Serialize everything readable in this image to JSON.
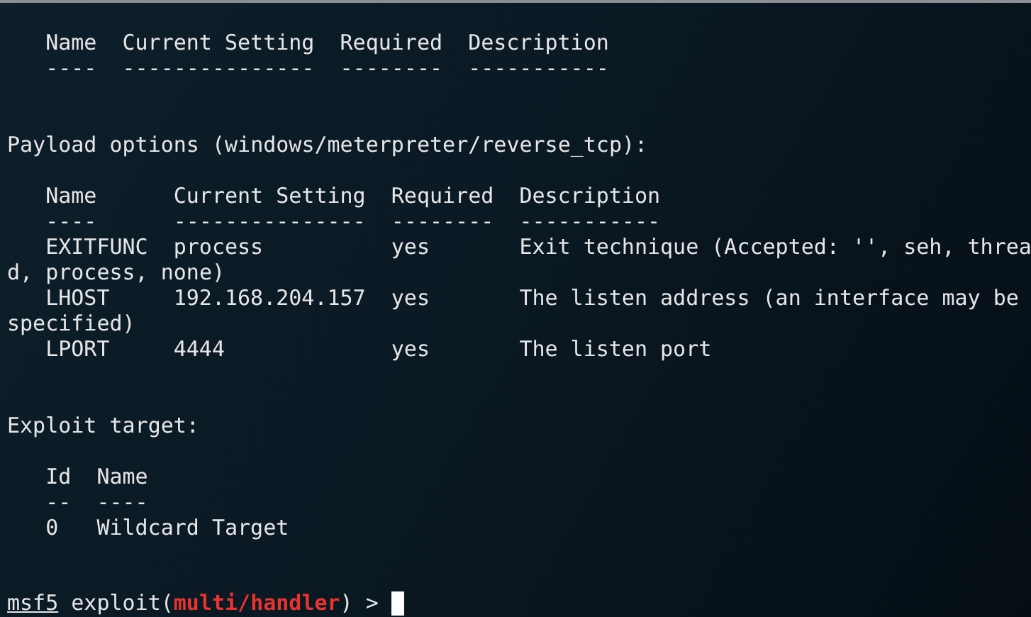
{
  "terminal": {
    "blocks": [
      {
        "kind": "table",
        "columns": [
          {
            "title": "Name",
            "rule": "----"
          },
          {
            "title": "Current Setting",
            "rule": "---------------"
          },
          {
            "title": "Required",
            "rule": "--------"
          },
          {
            "title": "Description",
            "rule": "-----------"
          }
        ]
      },
      {
        "kind": "heading",
        "text": "Payload options (windows/meterpreter/reverse_tcp):"
      },
      {
        "kind": "table",
        "columns": [
          {
            "title": "Name",
            "rule": "----"
          },
          {
            "title": "Current Setting",
            "rule": "---------------"
          },
          {
            "title": "Required",
            "rule": "--------"
          },
          {
            "title": "Description",
            "rule": "-----------"
          }
        ],
        "rows": [
          [
            "EXITFUNC",
            "process",
            "yes",
            "Exit technique (Accepted: '', seh, thread, process, none)"
          ],
          [
            "LHOST",
            "192.168.204.157",
            "yes",
            "The listen address (an interface may be specified)"
          ],
          [
            "LPORT",
            "4444",
            "yes",
            "The listen port"
          ]
        ]
      },
      {
        "kind": "heading",
        "text": "Exploit target:"
      },
      {
        "kind": "table",
        "columns": [
          {
            "title": "Id",
            "rule": "--"
          },
          {
            "title": "Name",
            "rule": "----"
          }
        ],
        "rows": [
          [
            "0",
            "Wildcard Target"
          ]
        ]
      },
      {
        "kind": "prompt",
        "host": "msf5",
        "command": "exploit(",
        "module": "multi/handler",
        "suffix": ") >"
      }
    ]
  }
}
